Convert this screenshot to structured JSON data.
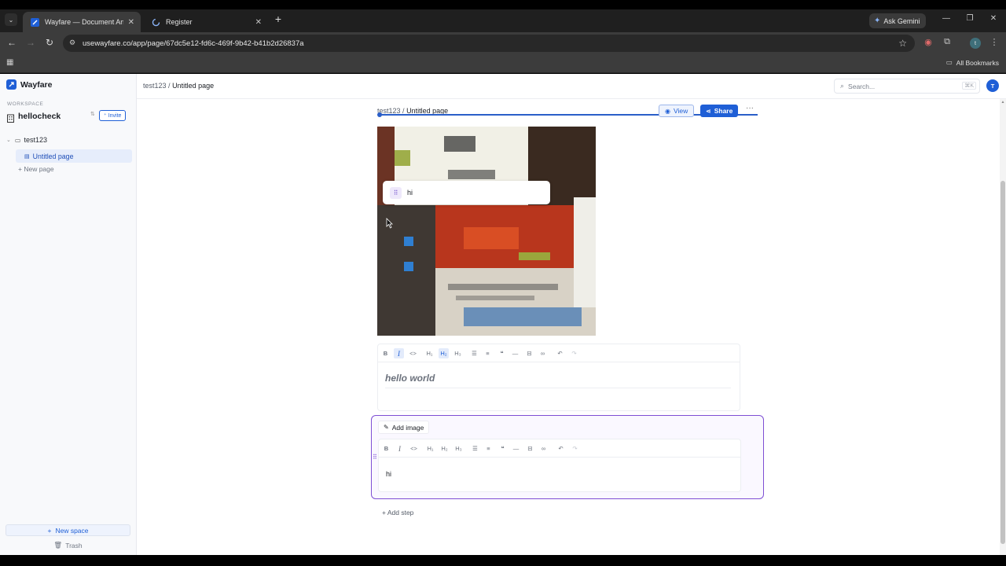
{
  "browser": {
    "tabs": [
      {
        "title": "Wayfare — Document Any Wo",
        "active": true
      },
      {
        "title": "Register",
        "active": false
      }
    ],
    "ask_gemini": "Ask Gemini",
    "url": "usewayfare.co/app/page/67dc5e12-fd6c-469f-9b42-b41b2d26837a",
    "all_bookmarks": "All Bookmarks",
    "profile_initial": "t"
  },
  "sidebar": {
    "brand": "Wayfare",
    "workspace_label": "WORKSPACE",
    "workspace_name": "hellocheck",
    "invite_label": "Invite",
    "space": "test123",
    "pages": [
      {
        "label": "Untitled page"
      }
    ],
    "new_page": "New page",
    "new_space": "New space",
    "trash": "Trash"
  },
  "topbar": {
    "breadcrumb_space": "test123",
    "breadcrumb_page": "Untitled page",
    "search_placeholder": "Search...",
    "search_shortcut": "⌘K",
    "avatar_initial": "T"
  },
  "doc": {
    "breadcrumb_space": "test123",
    "breadcrumb_page": "Untitled page",
    "view_label": "View",
    "share_label": "Share",
    "floating_step_text": "hi",
    "editor1_text": "hello world",
    "add_image_label": "Add image",
    "editor2_text": "hi",
    "add_step_label": "Add step"
  },
  "colors": {
    "accent": "#1f5fd6",
    "step_border": "#7e4fd4"
  }
}
